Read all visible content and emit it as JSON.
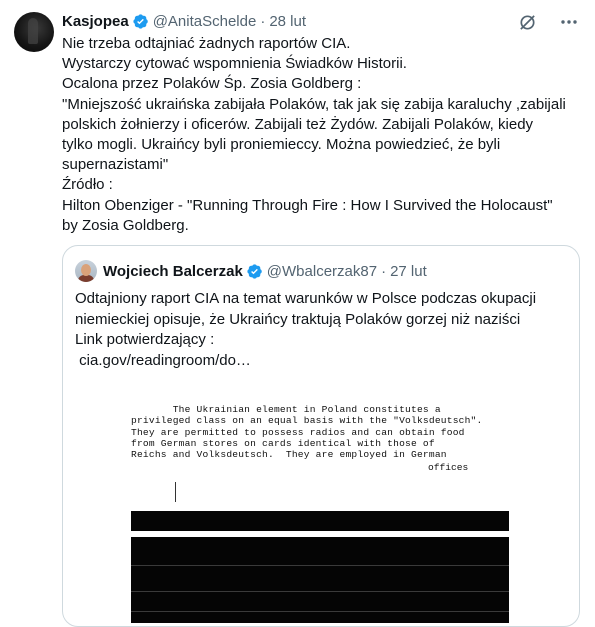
{
  "tweet": {
    "author_name": "Kasjopea",
    "author_handle": "@AnitaSchelde",
    "separator": "·",
    "time": "28 lut",
    "lines": [
      "Nie trzeba odtajniać żadnych raportów CIA.",
      "Wystarczy cytować wspomnienia Świadków Historii.",
      "Ocalona przez Polaków Śp. Zosia Goldberg :",
      "\"Mniejszość ukraińska zabijała Polaków, tak jak się zabija karaluchy ,zabijali",
      "polskich żołnierzy i oficerów. Zabijali też Żydów. Zabijali Polaków, kiedy",
      "tylko mogli. Ukraińcy byli proniemieccy. Można powiedzieć, że byli",
      "supernazistami\"",
      "Źródło :",
      "Hilton Obenziger - \"Running Through Fire : How I Survived the Holocaust\"",
      "by Zosia Goldberg."
    ]
  },
  "icons": {
    "verified": "verified-badge-icon",
    "grok": "grok-icon",
    "more": "more-icon",
    "accent": "#1d9bf0"
  },
  "quote": {
    "author_name": "Wojciech Balcerzak",
    "author_handle": "@Wbalcerzak87",
    "separator": "·",
    "time": "27 lut",
    "lines": [
      "Odtajniony raport CIA na temat warunków w Polsce podczas okupacji",
      "niemieckiej opisuje, że Ukraińcy traktują Polaków gorzej niż naziści",
      "",
      "Link potwierdzający :",
      " cia.gov/readingroom/do…"
    ]
  },
  "document": {
    "lines": [
      "       The Ukrainian element in Poland constitutes a",
      "privileged class on an equal basis with the \"Volksdeutsch\".",
      "They are permitted to possess radios and can obtain food",
      "from German stores on cards identical with those of",
      "Reichs and Volksdeutsch.  They are employed in German"
    ],
    "trailing_word": "offices"
  }
}
